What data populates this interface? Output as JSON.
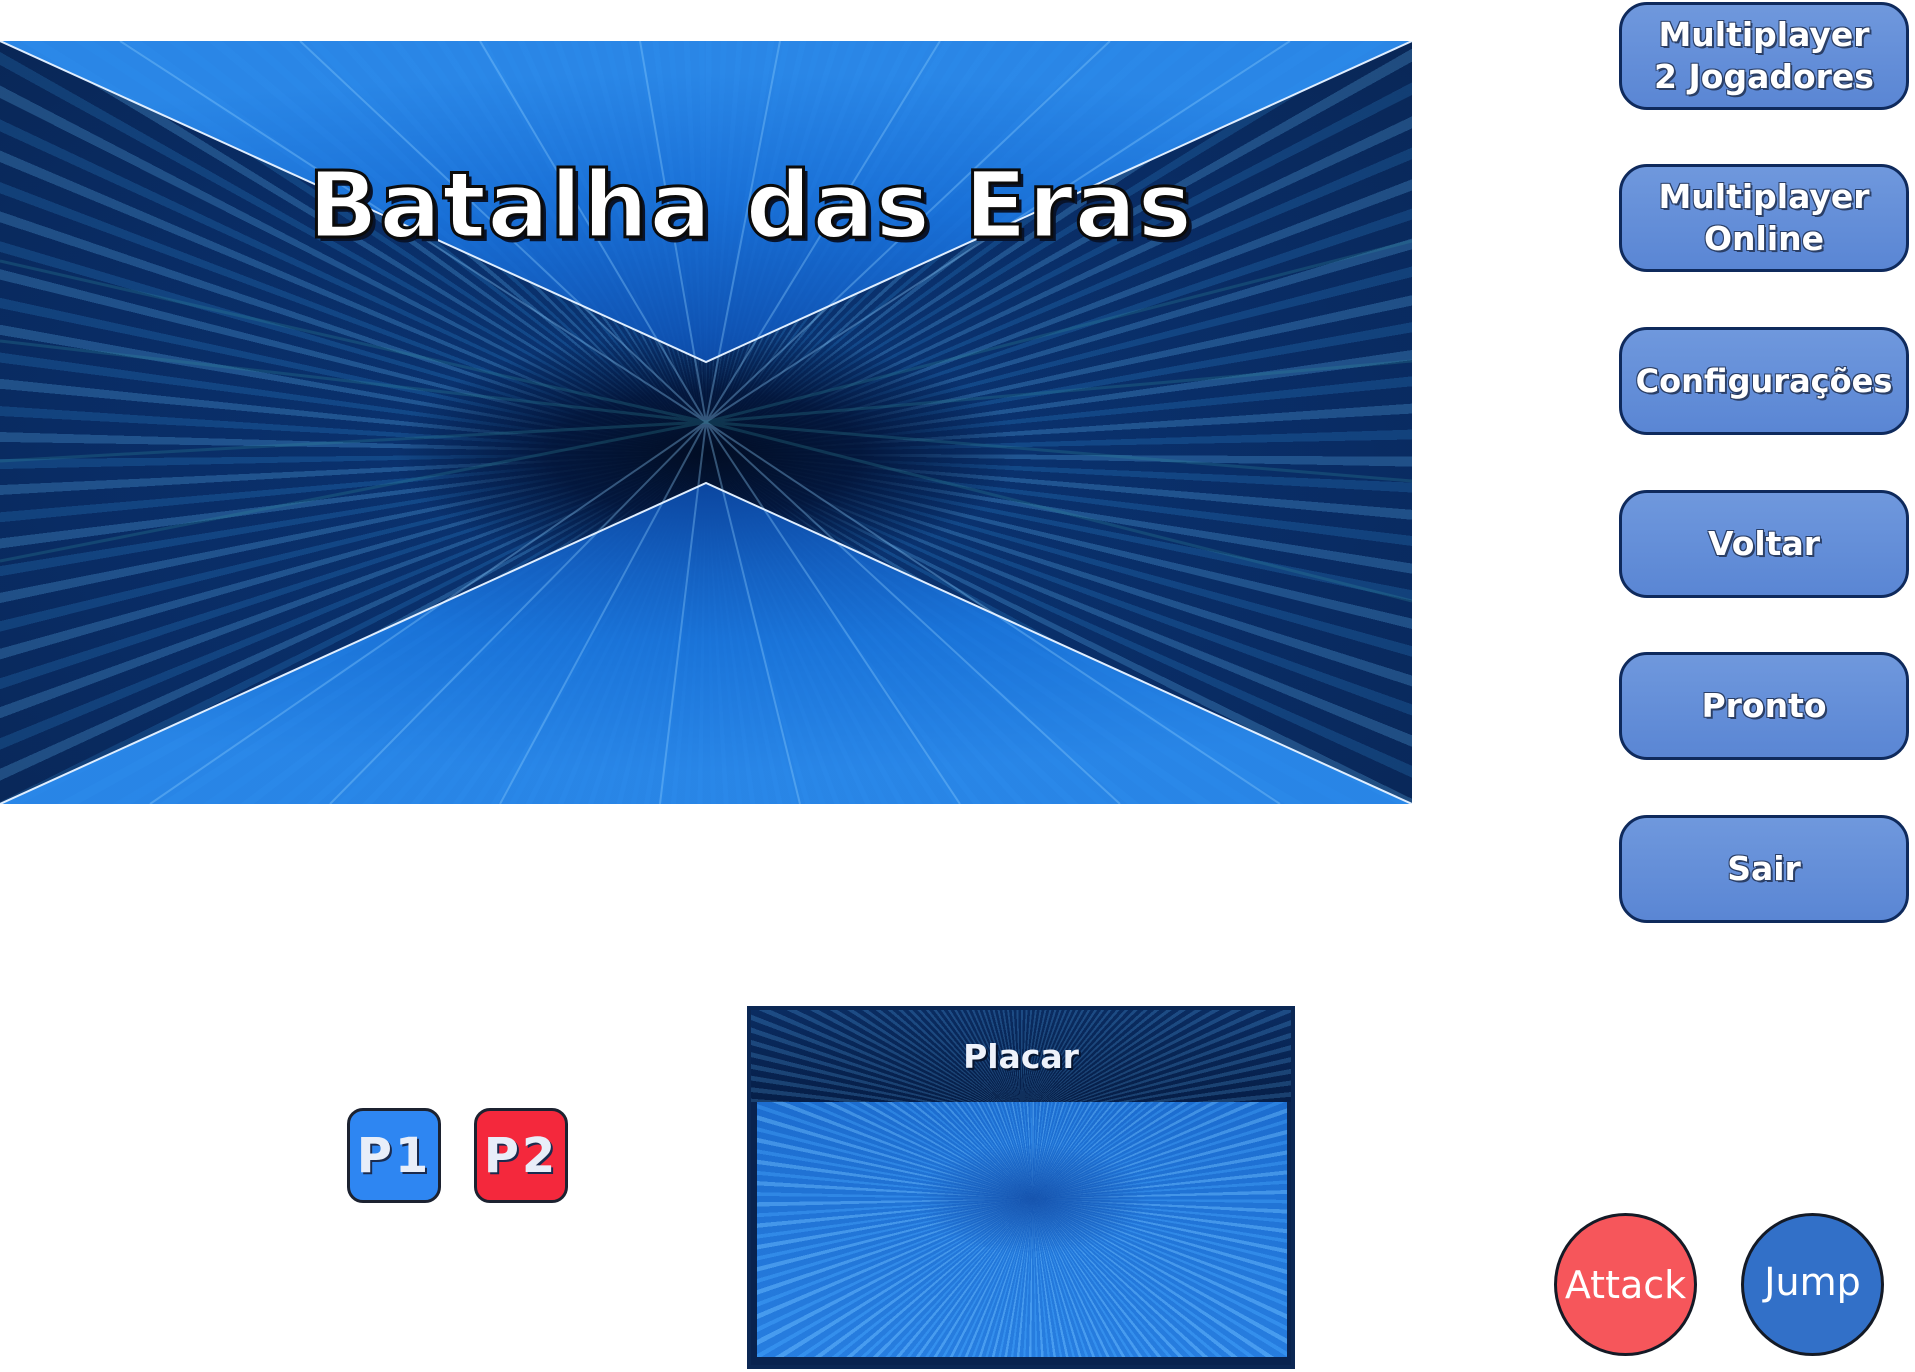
{
  "title_banner": {
    "title": "Batalha das Eras"
  },
  "menu": {
    "items": [
      {
        "label": "Multiplayer\n2 Jogadores"
      },
      {
        "label": "Multiplayer\nOnline"
      },
      {
        "label": "Configurações"
      },
      {
        "label": "Voltar"
      },
      {
        "label": "Pronto"
      },
      {
        "label": "Sair"
      }
    ]
  },
  "players": [
    {
      "label": "P1",
      "color": "#2e86f2"
    },
    {
      "label": "P2",
      "color": "#f4283c"
    }
  ],
  "scoreboard": {
    "title": "Placar"
  },
  "actions": {
    "attack_label": "Attack",
    "attack_color": "#f6565b",
    "jump_label": "Jump",
    "jump_color": "#3270c8"
  },
  "colors": {
    "menu_button": "#5a86d4",
    "menu_border": "#0f2a5c",
    "banner_light": "#1f7fe8",
    "banner_dark": "#041838"
  }
}
